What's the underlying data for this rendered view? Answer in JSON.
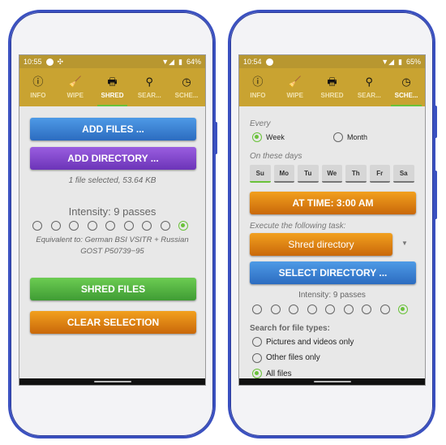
{
  "tabs": [
    {
      "label": "INFO",
      "icon": "info-icon"
    },
    {
      "label": "WIPE",
      "icon": "broom-icon"
    },
    {
      "label": "SHRED",
      "icon": "shredder-icon"
    },
    {
      "label": "SEAR...",
      "icon": "search-icon"
    },
    {
      "label": "SCHE...",
      "icon": "clock-icon"
    }
  ],
  "left": {
    "status": {
      "time": "10:55",
      "battery": "64%"
    },
    "active_tab": "SHRED",
    "add_files": "ADD FILES ...",
    "add_directory": "ADD DIRECTORY ...",
    "selection_info": "1 file selected, 53.64 KB",
    "intensity": "Intensity: 9 passes",
    "intensity_level": 9,
    "equivalent_line1": "Equivalent to: German BSI VSITR + Russian",
    "equivalent_line2": "GOST P50739−95",
    "shred_files": "SHRED FILES",
    "clear_selection": "CLEAR SELECTION"
  },
  "right": {
    "status": {
      "time": "10:54",
      "battery": "65%"
    },
    "active_tab": "SCHE...",
    "every_label": "Every",
    "week": "Week",
    "month": "Month",
    "selected_period": "Week",
    "days_label": "On these days",
    "days": [
      "Su",
      "Mo",
      "Tu",
      "We",
      "Th",
      "Fr",
      "Sa"
    ],
    "at_time": "AT TIME: 3:00 AM",
    "execute_label": "Execute the following task:",
    "task": "Shred directory",
    "select_directory": "SELECT DIRECTORY ...",
    "intensity": "Intensity: 9 passes",
    "intensity_level": 9,
    "file_types_label": "Search for file types:",
    "file_types": [
      "Pictures and videos only",
      "Other files only",
      "All files"
    ],
    "selected_file_type": "All files"
  },
  "colors": {
    "toolbar": "#c9a331",
    "status": "#b89730",
    "accent": "#6ac23a",
    "frame": "#3a50c0"
  }
}
